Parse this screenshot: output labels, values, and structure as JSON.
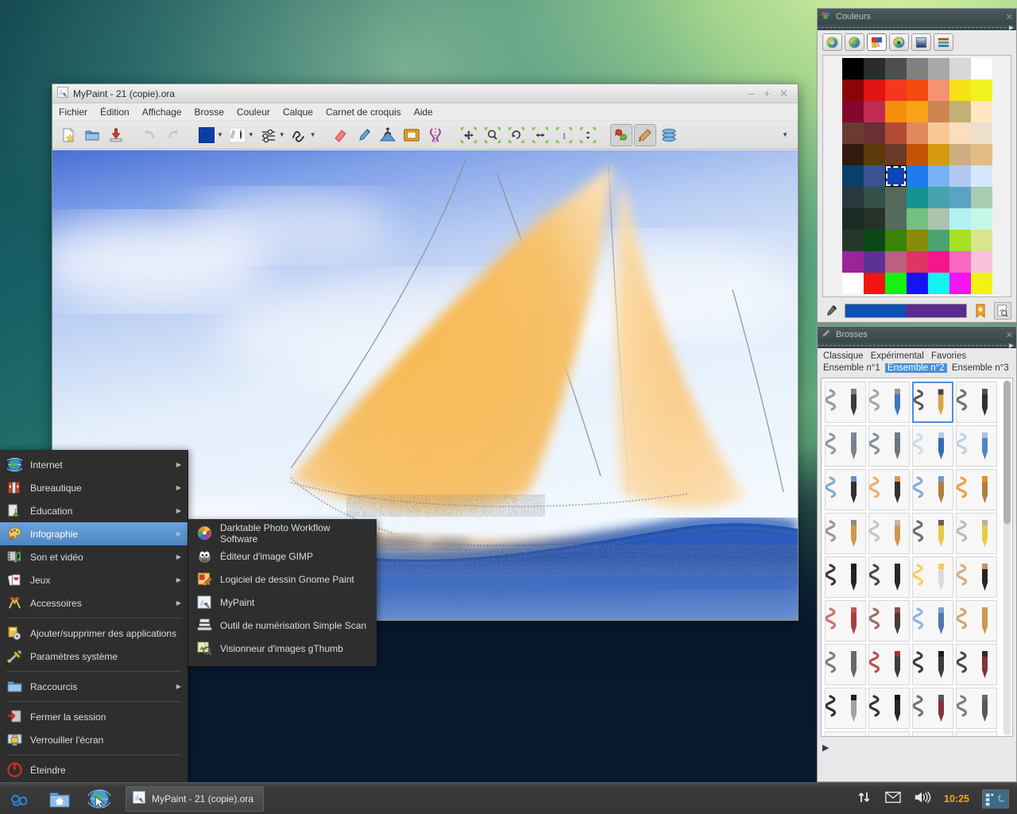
{
  "desktop": {
    "name": "linux-desktop"
  },
  "mypaint": {
    "title": "MyPaint - 21 (copie).ora",
    "window_icon": "mypaint-icon",
    "window_controls": {
      "minimize": "minimize-icon",
      "maximize": "maximize-icon",
      "close": "close-icon"
    },
    "menus": [
      "Fichier",
      "Édition",
      "Affichage",
      "Brosse",
      "Couleur",
      "Calque",
      "Carnet de croquis",
      "Aide"
    ],
    "toolbar": [
      {
        "name": "new-document-button",
        "icon": "new-file-icon",
        "dropdown": false
      },
      {
        "name": "open-document-button",
        "icon": "open-folder-icon",
        "dropdown": false
      },
      {
        "name": "save-document-button",
        "icon": "save-disk-icon",
        "dropdown": false
      },
      {
        "name": "undo-button",
        "icon": "undo-arrow-icon",
        "dropdown": false
      },
      {
        "name": "redo-button",
        "icon": "redo-arrow-icon",
        "dropdown": false
      },
      {
        "name": "color-swatch-button",
        "icon": "color-square-icon",
        "dropdown": true
      },
      {
        "name": "brush-selector-button",
        "icon": "pencil-icon",
        "dropdown": true
      },
      {
        "name": "brush-settings-button",
        "icon": "sliders-icon",
        "dropdown": true
      },
      {
        "name": "scratchpad-button",
        "icon": "squiggle-icon",
        "dropdown": true
      },
      {
        "name": "eraser-button",
        "icon": "eraser-icon",
        "dropdown": false
      },
      {
        "name": "color-picker-button",
        "icon": "eyedropper-icon",
        "dropdown": false
      },
      {
        "name": "layers-button",
        "icon": "layer-stack-icon",
        "dropdown": false
      },
      {
        "name": "frame-button",
        "icon": "picture-frame-icon",
        "dropdown": false
      },
      {
        "name": "symmetry-button",
        "icon": "symmetry-icon",
        "dropdown": false
      },
      {
        "name": "pan-view-button",
        "icon": "move-arrows-icon",
        "dropdown": false
      },
      {
        "name": "zoom-view-button",
        "icon": "magnifier-icon",
        "dropdown": false
      },
      {
        "name": "rotate-view-button",
        "icon": "rotate-icon",
        "dropdown": false
      },
      {
        "name": "mirror-view-button",
        "icon": "mirror-icon",
        "dropdown": false
      },
      {
        "name": "reset-zoom-button",
        "icon": "one-to-one-icon",
        "dropdown": false
      },
      {
        "name": "fit-view-button",
        "icon": "fit-window-icon",
        "dropdown": false
      },
      {
        "name": "color-history-button",
        "icon": "color-balloons-icon",
        "dropdown": false
      },
      {
        "name": "brush-panel-toggle",
        "icon": "paintbrush-icon",
        "dropdown": false
      },
      {
        "name": "layers-panel-toggle",
        "icon": "layers-stack-icon",
        "dropdown": false
      },
      {
        "name": "toolbar-overflow-button",
        "icon": "chevron-down-icon",
        "dropdown": false
      }
    ]
  },
  "colors_panel": {
    "title": "Couleurs",
    "panel_icon": "colors-icon",
    "close_icon": "close-icon",
    "expand_icon": "expand-arrow-icon",
    "tabs": [
      {
        "name": "hsv-wheel-tab",
        "icon": "color-wheel-icon",
        "selected": false
      },
      {
        "name": "hcy-wheel-tab",
        "icon": "color-wheel-alt-icon",
        "selected": false
      },
      {
        "name": "palette-tab",
        "icon": "palette-hand-icon",
        "selected": true
      },
      {
        "name": "color-ring-tab",
        "icon": "color-ring-icon",
        "selected": false
      },
      {
        "name": "rgb-square-tab",
        "icon": "gradient-square-icon",
        "selected": false
      },
      {
        "name": "sliders-tab",
        "icon": "color-sliders-icon",
        "selected": false
      }
    ],
    "palette": {
      "columns": 7,
      "rows": 11,
      "selected_index": 37,
      "swatches": [
        "#000000",
        "#2b2b2b",
        "#4e4e4e",
        "#808080",
        "#a9a9a9",
        "#d8d8d8",
        "#ffffff",
        "#8a0606",
        "#e01414",
        "#f43820",
        "#f24a10",
        "#f5926f",
        "#f7e11c",
        "#f2f221",
        "#84082e",
        "#c32a52",
        "#f78f0a",
        "#f9a318",
        "#cf8552",
        "#c3b178",
        "#fde6c0",
        "#6b3a33",
        "#6b2f33",
        "#b14b36",
        "#e08a5e",
        "#f9c796",
        "#fbddc0",
        "#ece0cc",
        "#321a0d",
        "#5e3a0a",
        "#6b3a2b",
        "#c45405",
        "#d49a10",
        "#cfae83",
        "#e1bd85",
        "#0b4069",
        "#3a5291",
        "#0e47b5",
        "#1f7bf0",
        "#76b1f4",
        "#b2c8f2",
        "#d6e7fb",
        "#27393c",
        "#335049",
        "#56675c",
        "#159391",
        "#45a4ab",
        "#5ba3c4",
        "#a6cdb0",
        "#1c2b23",
        "#253229",
        "#556b5c",
        "#74c184",
        "#acc3ae",
        "#b5f0f2",
        "#c6f7e6",
        "#26382b",
        "#0b4a18",
        "#3a8208",
        "#8a8a0b",
        "#4aa372",
        "#a6e024",
        "#d9e58c",
        "#9b2596",
        "#5b3293",
        "#bd5f7e",
        "#e03462",
        "#f5158e",
        "#f768c3",
        "#f9c1da",
        "#ffffff",
        "#f21313",
        "#14f214",
        "#1414f2",
        "#14f2f2",
        "#f214f2",
        "#f2f214"
      ]
    },
    "footer": {
      "picker_icon": "eyedropper-icon",
      "current_color": "#0d52b3",
      "previous_color": "#5a2d8c",
      "bookmark_icon": "bookmark-star-icon",
      "edit_icon": "edit-palette-icon"
    }
  },
  "brushes_panel": {
    "title": "Brosses",
    "panel_icon": "brush-icon",
    "close_icon": "close-icon",
    "expand_icon": "expand-arrow-icon",
    "tabs": [
      {
        "label": "Classique",
        "selected": false
      },
      {
        "label": "Expérimental",
        "selected": false
      },
      {
        "label": "Favories",
        "selected": false
      },
      {
        "label": "Ensemble n°1",
        "selected": false
      },
      {
        "label": "Ensemble n°2",
        "selected": true
      },
      {
        "label": "Ensemble n°3",
        "selected": false
      }
    ],
    "selected_brush_index": 2,
    "brushes": [
      {
        "name": "marker-brush",
        "stroke": "#8a8a8a",
        "tool": "marker-dark",
        "tip": "#2a2a2a"
      },
      {
        "name": "pencil-blue-brush",
        "stroke": "#9a9a9a",
        "tool": "pencil-blue",
        "tip": "#2f6fb5"
      },
      {
        "name": "pencil-dark-brush",
        "stroke": "#3a3a3a",
        "tool": "pencil-dark",
        "tip": "#d89a3c"
      },
      {
        "name": "technical-pen-brush",
        "stroke": "#5a5a5a",
        "tool": "pen-black",
        "tip": "#1f1f1f"
      },
      {
        "name": "charcoal-brush",
        "stroke": "#7a8a96",
        "tool": "charcoal-grey",
        "tip": "#6c7b87"
      },
      {
        "name": "soft-pastel-brush",
        "stroke": "#6e7f8c",
        "tool": "pastel-grey",
        "tip": "#5d6d79"
      },
      {
        "name": "glue-stick-brush",
        "stroke": "#c8d6e8",
        "tool": "stick-blue",
        "tip": "#1f5fa8"
      },
      {
        "name": "spray-can-brush",
        "stroke": "#b5c9dd",
        "tool": "spray-blue",
        "tip": "#3f7fc0"
      },
      {
        "name": "ink-brush-blue",
        "stroke": "#6f9ed0",
        "tool": "pen-black",
        "tip": "#1f1f1f"
      },
      {
        "name": "ink-brush-orange",
        "stroke": "#f0a055",
        "tool": "pen-black",
        "tip": "#1f1f1f"
      },
      {
        "name": "flat-brush-blue",
        "stroke": "#6f9ed0",
        "tool": "brush-wood",
        "tip": "#a9752e"
      },
      {
        "name": "flat-brush-orange",
        "stroke": "#ee8f20",
        "tool": "brush-wood",
        "tip": "#a9752e"
      },
      {
        "name": "bristle-brush-grey",
        "stroke": "#8a8a8a",
        "tool": "brush-tan",
        "tip": "#c98f3c"
      },
      {
        "name": "bristle-brush-soft",
        "stroke": "#bdbdbd",
        "tool": "brush-tan",
        "tip": "#c98f3c"
      },
      {
        "name": "sketch-brush-dark",
        "stroke": "#565656",
        "tool": "brush-yellow",
        "tip": "#e8c43a"
      },
      {
        "name": "sketch-brush-light",
        "stroke": "#b0b0b0",
        "tool": "brush-yellow",
        "tip": "#e8c43a"
      },
      {
        "name": "calligraphy-pen",
        "stroke": "#1a1a1a",
        "tool": "nib-black",
        "tip": "#141414"
      },
      {
        "name": "calligraphy-pen-fine",
        "stroke": "#2a2a2a",
        "tool": "nib-black",
        "tip": "#141414"
      },
      {
        "name": "watercolor-yellow",
        "stroke": "#f5c84a",
        "tool": "brush-white",
        "tip": "#d8d8d8"
      },
      {
        "name": "watercolor-tan",
        "stroke": "#dba063",
        "tool": "nib-black",
        "tip": "#141414"
      },
      {
        "name": "oil-brush-red",
        "stroke": "#c45a5a",
        "tool": "brush-red",
        "tip": "#9c3030"
      },
      {
        "name": "oil-brush-brown",
        "stroke": "#8a5a44",
        "tool": "brush-dark",
        "tip": "#3a2a22"
      },
      {
        "name": "water-drop-brush",
        "stroke": "#7fa8d8",
        "tool": "brush-blue",
        "tip": "#3f6fa8"
      },
      {
        "name": "dry-brush-tan",
        "stroke": "#c79a5c",
        "tool": "brush-tan",
        "tip": "#c98f3c"
      },
      {
        "name": "loop-brush",
        "stroke": "#6a6a6a",
        "tool": "brush-thin",
        "tip": "#5a5a5a"
      },
      {
        "name": "text-brush",
        "stroke": "#b03030",
        "tool": "marker-dark",
        "tip": "#2a2a2a"
      },
      {
        "name": "blocky-brush",
        "stroke": "#1a1a1a",
        "tool": "marker-square",
        "tip": "#2a2a2a"
      },
      {
        "name": "outline-brush",
        "stroke": "#2a2a2a",
        "tool": "marker-maroon",
        "tip": "#7a2030"
      },
      {
        "name": "ink-blob-brush",
        "stroke": "#0f0f0f",
        "tool": "nib-silver",
        "tip": "#9a9a9a"
      },
      {
        "name": "splatter-brush",
        "stroke": "#121212",
        "tool": "nib-black",
        "tip": "#141414"
      },
      {
        "name": "grain-brush",
        "stroke": "#5a5a5a",
        "tool": "marker-maroon",
        "tip": "#7a2030"
      },
      {
        "name": "noise-brush",
        "stroke": "#6a6a6a",
        "tool": "spray-grey",
        "tip": "#4a4a4a"
      },
      {
        "name": "chalk-blue-brush",
        "stroke": "#7f93c0",
        "tool": "stick-blue",
        "tip": "#7f93c0"
      },
      {
        "name": "smudge-finger-brush",
        "stroke": "#b8a8a0",
        "tool": "finger",
        "tip": "#d8956a"
      },
      {
        "name": "blur-drop-brush",
        "stroke": "#d8d8d8",
        "tool": "eraser-white",
        "tip": "#e8e8e8"
      },
      {
        "name": "soft-airbrush",
        "stroke": "#5a5a5a",
        "tool": "airbrush-black",
        "tip": "#1f1f1f"
      }
    ],
    "footer_icon": "expand-arrow-icon"
  },
  "start_menu": {
    "items": [
      {
        "label": "Internet",
        "icon": "globe-icon",
        "submenu": true,
        "selected": false
      },
      {
        "label": "Bureautique",
        "icon": "office-books-icon",
        "submenu": true,
        "selected": false
      },
      {
        "label": "Éducation",
        "icon": "education-flask-icon",
        "submenu": true,
        "selected": false
      },
      {
        "label": "Infographie",
        "icon": "graphics-palette-icon",
        "submenu": true,
        "selected": true
      },
      {
        "label": "Son et vidéo",
        "icon": "multimedia-icon",
        "submenu": true,
        "selected": false
      },
      {
        "label": "Jeux",
        "icon": "games-cards-icon",
        "submenu": true,
        "selected": false
      },
      {
        "label": "Accessoires",
        "icon": "accessories-icon",
        "submenu": true,
        "selected": false
      }
    ],
    "system_items": [
      {
        "label": "Ajouter/supprimer des applications",
        "icon": "add-remove-apps-icon",
        "submenu": false
      },
      {
        "label": "Paramètres système",
        "icon": "system-settings-icon",
        "submenu": false
      }
    ],
    "places_items": [
      {
        "label": "Raccourcis",
        "icon": "folder-icon",
        "submenu": true
      }
    ],
    "session_items": [
      {
        "label": "Fermer la session",
        "icon": "logout-icon",
        "submenu": false
      },
      {
        "label": "Verrouiller l'écran",
        "icon": "lock-screen-icon",
        "submenu": false
      }
    ],
    "power_items": [
      {
        "label": "Éteindre",
        "icon": "power-icon",
        "submenu": false
      }
    ]
  },
  "submenu": {
    "items": [
      {
        "label": "Darktable Photo Workflow Software",
        "icon": "darktable-icon"
      },
      {
        "label": "Éditeur d'image GIMP",
        "icon": "gimp-icon"
      },
      {
        "label": "Logiciel de dessin Gnome Paint",
        "icon": "gnome-paint-icon"
      },
      {
        "label": "MyPaint",
        "icon": "mypaint-icon"
      },
      {
        "label": "Outil de numérisation Simple Scan",
        "icon": "scanner-icon"
      },
      {
        "label": "Visionneur d'images gThumb",
        "icon": "gthumb-icon"
      }
    ]
  },
  "taskbar": {
    "launchers": [
      {
        "name": "start-menu-button",
        "icon": "spiral-logo-icon"
      },
      {
        "name": "file-manager-launcher",
        "icon": "home-folder-icon"
      },
      {
        "name": "web-browser-launcher",
        "icon": "globe-cursor-icon"
      }
    ],
    "tasks": [
      {
        "label": "MyPaint - 21 (copie).ora",
        "icon": "mypaint-icon",
        "active": true
      }
    ],
    "tray": [
      {
        "name": "network-icon",
        "icon": "network-arrows-icon"
      },
      {
        "name": "mail-icon",
        "icon": "envelope-icon"
      },
      {
        "name": "volume-icon",
        "icon": "speaker-icon"
      }
    ],
    "clock": "10:25",
    "workspace_switcher": "workspace-switcher-icon"
  },
  "artwork": {
    "name": "sailboat-painting",
    "description": "Sailboat with orange sails on blue sea",
    "sky_color": "#dce9fb",
    "sea_color": "#2b5fbe",
    "sail_color": "#f5b55f",
    "hull_color": "#f7d3ac"
  }
}
